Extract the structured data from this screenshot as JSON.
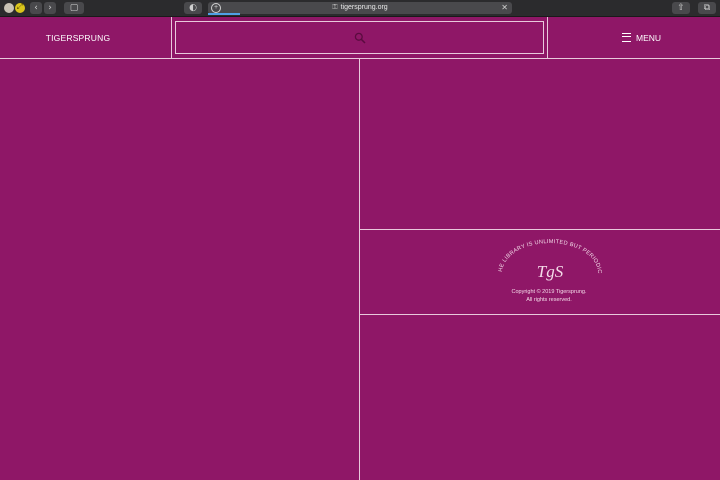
{
  "browser": {
    "url": "tigersprung.org",
    "lock_glyph": "⚿",
    "close_glyph": "✕",
    "new_tab_glyph": "+",
    "back_glyph": "‹",
    "forward_glyph": "›",
    "sidebar_glyph": "▢",
    "reader_glyph": "◐",
    "share_glyph": "⇧",
    "tabs_glyph": "⧉",
    "accent_color": "#4fa0e6"
  },
  "site": {
    "logo": "TIGERSPRUNG",
    "menu_label": "MENU",
    "search_icon": "search-icon",
    "menu_icon": "hamburger-icon",
    "background_color": "#8f1767",
    "line_color": "#e9c9dc"
  },
  "footer": {
    "tagline": "THE LIBRARY IS UNLIMITED BUT PERIODIC.",
    "monogram": "TgS",
    "copyright_line1": "Copyright © 2019 Tigersprung.",
    "copyright_line2": "All rights reserved."
  }
}
